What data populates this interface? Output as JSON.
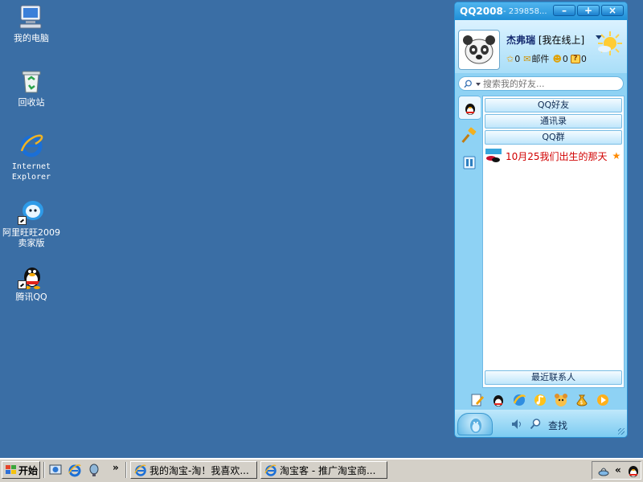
{
  "desktop": {
    "icons": [
      {
        "label": "我的电脑"
      },
      {
        "label": "回收站"
      },
      {
        "label": "Internet\nExplorer"
      },
      {
        "label": "阿里旺旺2009\n卖家版"
      },
      {
        "label": "腾讯QQ"
      }
    ]
  },
  "qq": {
    "title": "QQ2008",
    "number": "- 239858...",
    "window_buttons": {
      "minimize": "–",
      "maximize": "+",
      "close": "×"
    },
    "profile": {
      "nickname": "杰弗瑞",
      "status": "[我在线上]",
      "level_count": "0",
      "mail_label": "邮件",
      "qzone_count": "0",
      "unknown_count": "0",
      "unknown_icon": "?"
    },
    "search": {
      "placeholder": "搜索我的好友..."
    },
    "groups": [
      "QQ好友",
      "通讯录",
      "QQ群"
    ],
    "contact": {
      "name": "10月25我们出生的那天",
      "star": "★"
    },
    "recent_label": "最近联系人",
    "find_label": "查找"
  },
  "taskbar": {
    "start_label": "开始",
    "chevron": "»",
    "tray_chevron": "«",
    "tasks": [
      {
        "label": "我的淘宝-淘！我喜欢..."
      },
      {
        "label": "淘宝客 - 推广淘宝商..."
      }
    ]
  },
  "colors": {
    "desktop": "#3a6ea5",
    "qq_title": "#1f8fd8",
    "contact_name": "#d10000",
    "taskbar": "#d4d0c8"
  }
}
